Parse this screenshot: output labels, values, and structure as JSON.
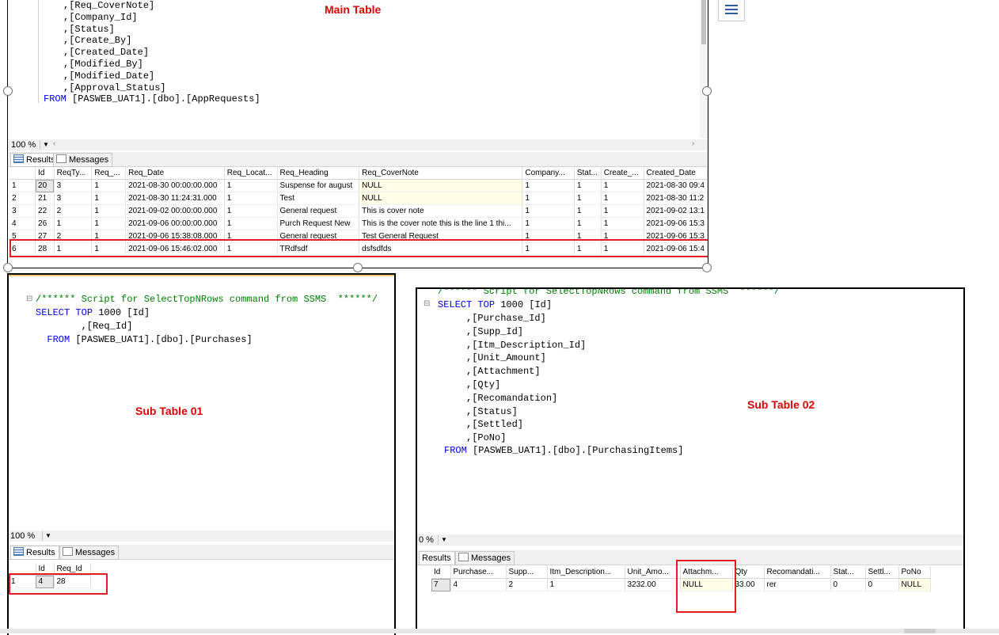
{
  "main": {
    "label": "Main Table",
    "code_lines": [
      ",[Req_CoverNote]",
      ",[Company_Id]",
      ",[Status]",
      ",[Create_By]",
      ",[Created_Date]",
      ",[Modified_By]",
      ",[Modified_Date]",
      ",[Approval_Status]"
    ],
    "from_kw": "FROM",
    "from_rest": " [PASWEB_UAT1].[dbo].[AppRequests]",
    "zoom": "100 %",
    "tab_results": "Results",
    "tab_messages": "Messages",
    "columns": [
      "Id",
      "ReqTy...",
      "Req_...",
      "Req_Date",
      "Req_Locat...",
      "Req_Heading",
      "Req_CoverNote",
      "Company...",
      "Stat...",
      "Create_...",
      "Created_Date"
    ],
    "rows": [
      [
        "1",
        "20",
        "3",
        "1",
        "2021-08-30 00:00:00.000",
        "1",
        "Suspense for august",
        "NULL",
        "1",
        "1",
        "1",
        "2021-08-30 09:4"
      ],
      [
        "2",
        "21",
        "3",
        "1",
        "2021-08-30 11:24:31.000",
        "1",
        "Test",
        "NULL",
        "1",
        "1",
        "1",
        "2021-08-30 11:2"
      ],
      [
        "3",
        "22",
        "2",
        "1",
        "2021-09-02 00:00:00.000",
        "1",
        "General request",
        "This is cover note",
        "1",
        "1",
        "1",
        "2021-09-02 13:1"
      ],
      [
        "4",
        "26",
        "1",
        "1",
        "2021-09-06 00:00:00.000",
        "1",
        "Purch Request New",
        "This is the cover note  this is the line 1  thi...",
        "1",
        "1",
        "1",
        "2021-09-06 15:3"
      ],
      [
        "5",
        "27",
        "2",
        "1",
        "2021-09-06 15:38:08.000",
        "1",
        "General request",
        "Test General Request",
        "1",
        "1",
        "1",
        "2021-09-06 15:3"
      ],
      [
        "6",
        "28",
        "1",
        "1",
        "2021-09-06 15:46:02.000",
        "1",
        "TRdfsdf",
        "dsfsdfds",
        "1",
        "1",
        "1",
        "2021-09-06 15:4"
      ]
    ]
  },
  "sub1": {
    "label": "Sub Table 01",
    "comment": "/****** Script for SelectTopNRows command from SSMS  ******/",
    "select_kw": "SELECT",
    "top_kw": "TOP",
    "select_rest": " 1000 [Id]",
    "col_line": ",[Req_Id]",
    "from_kw": "FROM",
    "from_rest": " [PASWEB_UAT1].[dbo].[Purchases]",
    "zoom": "100 %",
    "tab_results": "Results",
    "tab_messages": "Messages",
    "columns": [
      "Id",
      "Req_Id"
    ],
    "rows": [
      [
        "1",
        "4",
        "28"
      ]
    ]
  },
  "sub2": {
    "label": "Sub Table 02",
    "comment": "/****** Script for SelectTopNRows command from SSMS  ******/",
    "select_kw": "SELECT",
    "top_kw": "TOP",
    "select_rest": " 1000 [Id]",
    "code_lines": [
      ",[Purchase_Id]",
      ",[Supp_Id]",
      ",[Itm_Description_Id]",
      ",[Unit_Amount]",
      ",[Attachment]",
      ",[Qty]",
      ",[Recomandation]",
      ",[Status]",
      ",[Settled]",
      ",[PoNo]"
    ],
    "from_kw": "FROM",
    "from_rest": " [PASWEB_UAT1].[dbo].[PurchasingItems]",
    "zoom": "0 %",
    "tab_results": "Results",
    "tab_messages": "Messages",
    "columns": [
      "Id",
      "Purchase...",
      "Supp...",
      "Itm_Description...",
      "Unit_Amo...",
      "Attachm...",
      "Qty",
      "Recomandati...",
      "Stat...",
      "Settl...",
      "PoNo"
    ],
    "rows": [
      [
        "7",
        "4",
        "2",
        "1",
        "3232.00",
        "NULL",
        "33.00",
        "rer",
        "0",
        "0",
        "NULL"
      ]
    ]
  },
  "colors": {
    "keyword": "#0000ff",
    "comment": "#008000",
    "annotation": "#e31b23",
    "null_cell": "#fffde5"
  }
}
